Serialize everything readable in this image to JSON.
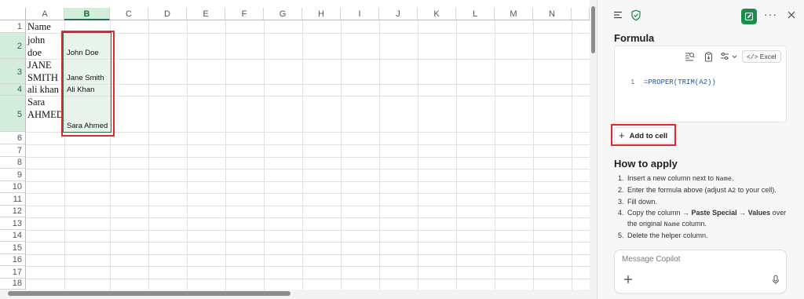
{
  "sheet": {
    "columns": [
      "A",
      "B",
      "C",
      "D",
      "E",
      "F",
      "G",
      "H",
      "I",
      "J",
      "K",
      "L",
      "M",
      "N"
    ],
    "rows": [
      "1",
      "2",
      "3",
      "4",
      "5",
      "6",
      "7",
      "8",
      "9",
      "10",
      "11",
      "12",
      "13",
      "14",
      "15",
      "16",
      "17",
      "18"
    ],
    "selected_column": "B",
    "cells_A": {
      "r1": "Name",
      "r2a": "john",
      "r2b": "doe",
      "r3a": "JANE",
      "r3b": "SMITH",
      "r4": "ali khan",
      "r5a": "Sara",
      "r5b": "AHMED"
    },
    "cells_B": {
      "r2": "John Doe",
      "r3": "Jane Smith",
      "r4": "Ali Khan",
      "r5": "Sara Ahmed"
    }
  },
  "copilot": {
    "header_icons": [
      "menu-icon",
      "shield-check-icon",
      "edit-icon",
      "more-icon",
      "close-icon"
    ],
    "formula_title": "Formula",
    "toolbar": {
      "excel_label": "Excel"
    },
    "code": {
      "line_number": "1",
      "formula": "=PROPER(TRIM(A2))"
    },
    "add_button_label": "Add to cell",
    "howto_title": "How to apply",
    "steps": {
      "s1_num": "1.",
      "s1_text": "Insert a new column next to ",
      "s1_code": "Name",
      "s1_end": ".",
      "s2_num": "2.",
      "s2_text": "Enter the formula above (adjust ",
      "s2_code": "A2",
      "s2_end": " to your cell).",
      "s3_num": "3.",
      "s3_text": "Fill down.",
      "s4_num": "4.",
      "s4_text": "Copy the column → ",
      "s4_bold": "Paste Special → Values",
      "s4_mid": " over the original ",
      "s4_code": "Name",
      "s4_end": " column.",
      "s5_num": "5.",
      "s5_text": "Delete the helper column."
    },
    "message_placeholder": "Message Copilot"
  },
  "colors": {
    "accent": "#217346",
    "highlight": "#e0282e",
    "copilot_green": "#1e8c4e",
    "code_blue": "#1b57a6"
  }
}
